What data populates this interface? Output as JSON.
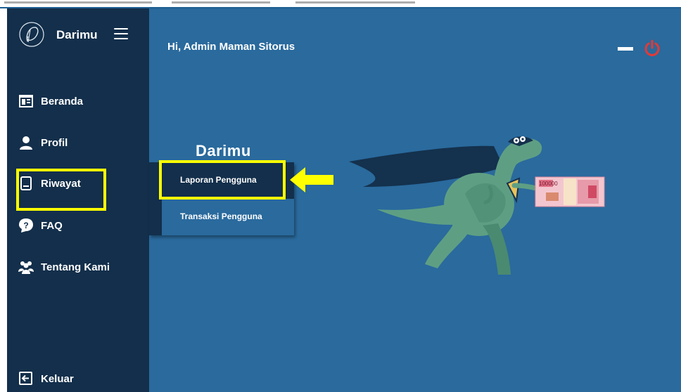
{
  "app": {
    "name": "Darimu",
    "greeting": "Hi, Admin Maman Sitorus"
  },
  "sidebar": {
    "items": [
      {
        "label": "Beranda",
        "icon": "home-window-icon"
      },
      {
        "label": "Profil",
        "icon": "user-icon"
      },
      {
        "label": "Riwayat",
        "icon": "history-book-icon"
      },
      {
        "label": "FAQ",
        "icon": "question-icon"
      },
      {
        "label": "Tentang Kami",
        "icon": "team-icon"
      }
    ],
    "logout_label": "Keluar"
  },
  "submenu": {
    "title": "Darimu",
    "items": [
      "Laporan Pengguna",
      "Transaksi Pengguna"
    ]
  },
  "illustration": {
    "banknote_value": "100000"
  },
  "colors": {
    "sidebar_bg": "#132f4b",
    "main_bg": "#2a6a9d",
    "highlight": "#ffff00",
    "power": "#e53935"
  }
}
